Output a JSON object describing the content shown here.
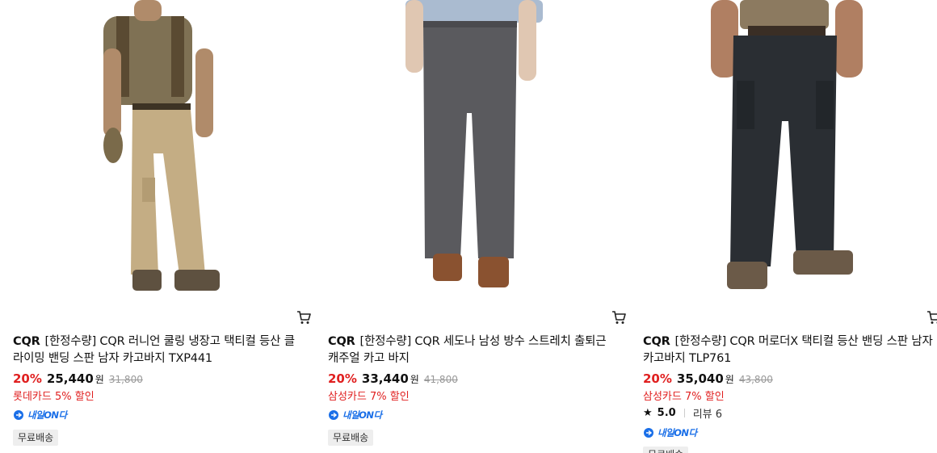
{
  "products": [
    {
      "brand": "CQR",
      "name": "[한정수량] CQR 러니언 쿨링 냉장고 택티컬 등산 클라이밍 밴딩 스판 남자 카고바지 TXP441",
      "discount": "20%",
      "price": "25,440",
      "currency": "원",
      "original_price": "31,800",
      "card_discount": "롯데카드 5% 할인",
      "delivery_badge": "내일ON다",
      "shipping": "무료배송",
      "pants_color": "#c4ad84",
      "shirt_color": "#7f7154"
    },
    {
      "brand": "CQR",
      "name": "[한정수량] CQR 세도나 남성 방수 스트레치 출퇴근 캐주얼 카고 바지",
      "discount": "20%",
      "price": "33,440",
      "currency": "원",
      "original_price": "41,800",
      "card_discount": "삼성카드 7% 할인",
      "delivery_badge": "내일ON다",
      "shipping": "무료배송",
      "pants_color": "#5a5a5e",
      "shirt_color": "#aabbd0"
    },
    {
      "brand": "CQR",
      "name": "[한정수량] CQR 머로더X 택티컬 등산 밴딩 스판 남자 카고바지 TLP761",
      "discount": "20%",
      "price": "35,040",
      "currency": "원",
      "original_price": "43,800",
      "card_discount": "삼성카드 7% 할인",
      "rating": "5.0",
      "reviews": "리뷰 6",
      "delivery_badge": "내일ON다",
      "shipping": "무료배송",
      "pants_color": "#2a2e33",
      "shirt_color": "#8c7a60"
    }
  ],
  "colors": {
    "discount_red": "#e02020",
    "badge_blue": "#1a6fe8",
    "tag_bg": "#eeeeee"
  },
  "icons": {
    "cart": "cart-icon",
    "star": "star-icon",
    "delivery": "delivery-truck-icon"
  }
}
